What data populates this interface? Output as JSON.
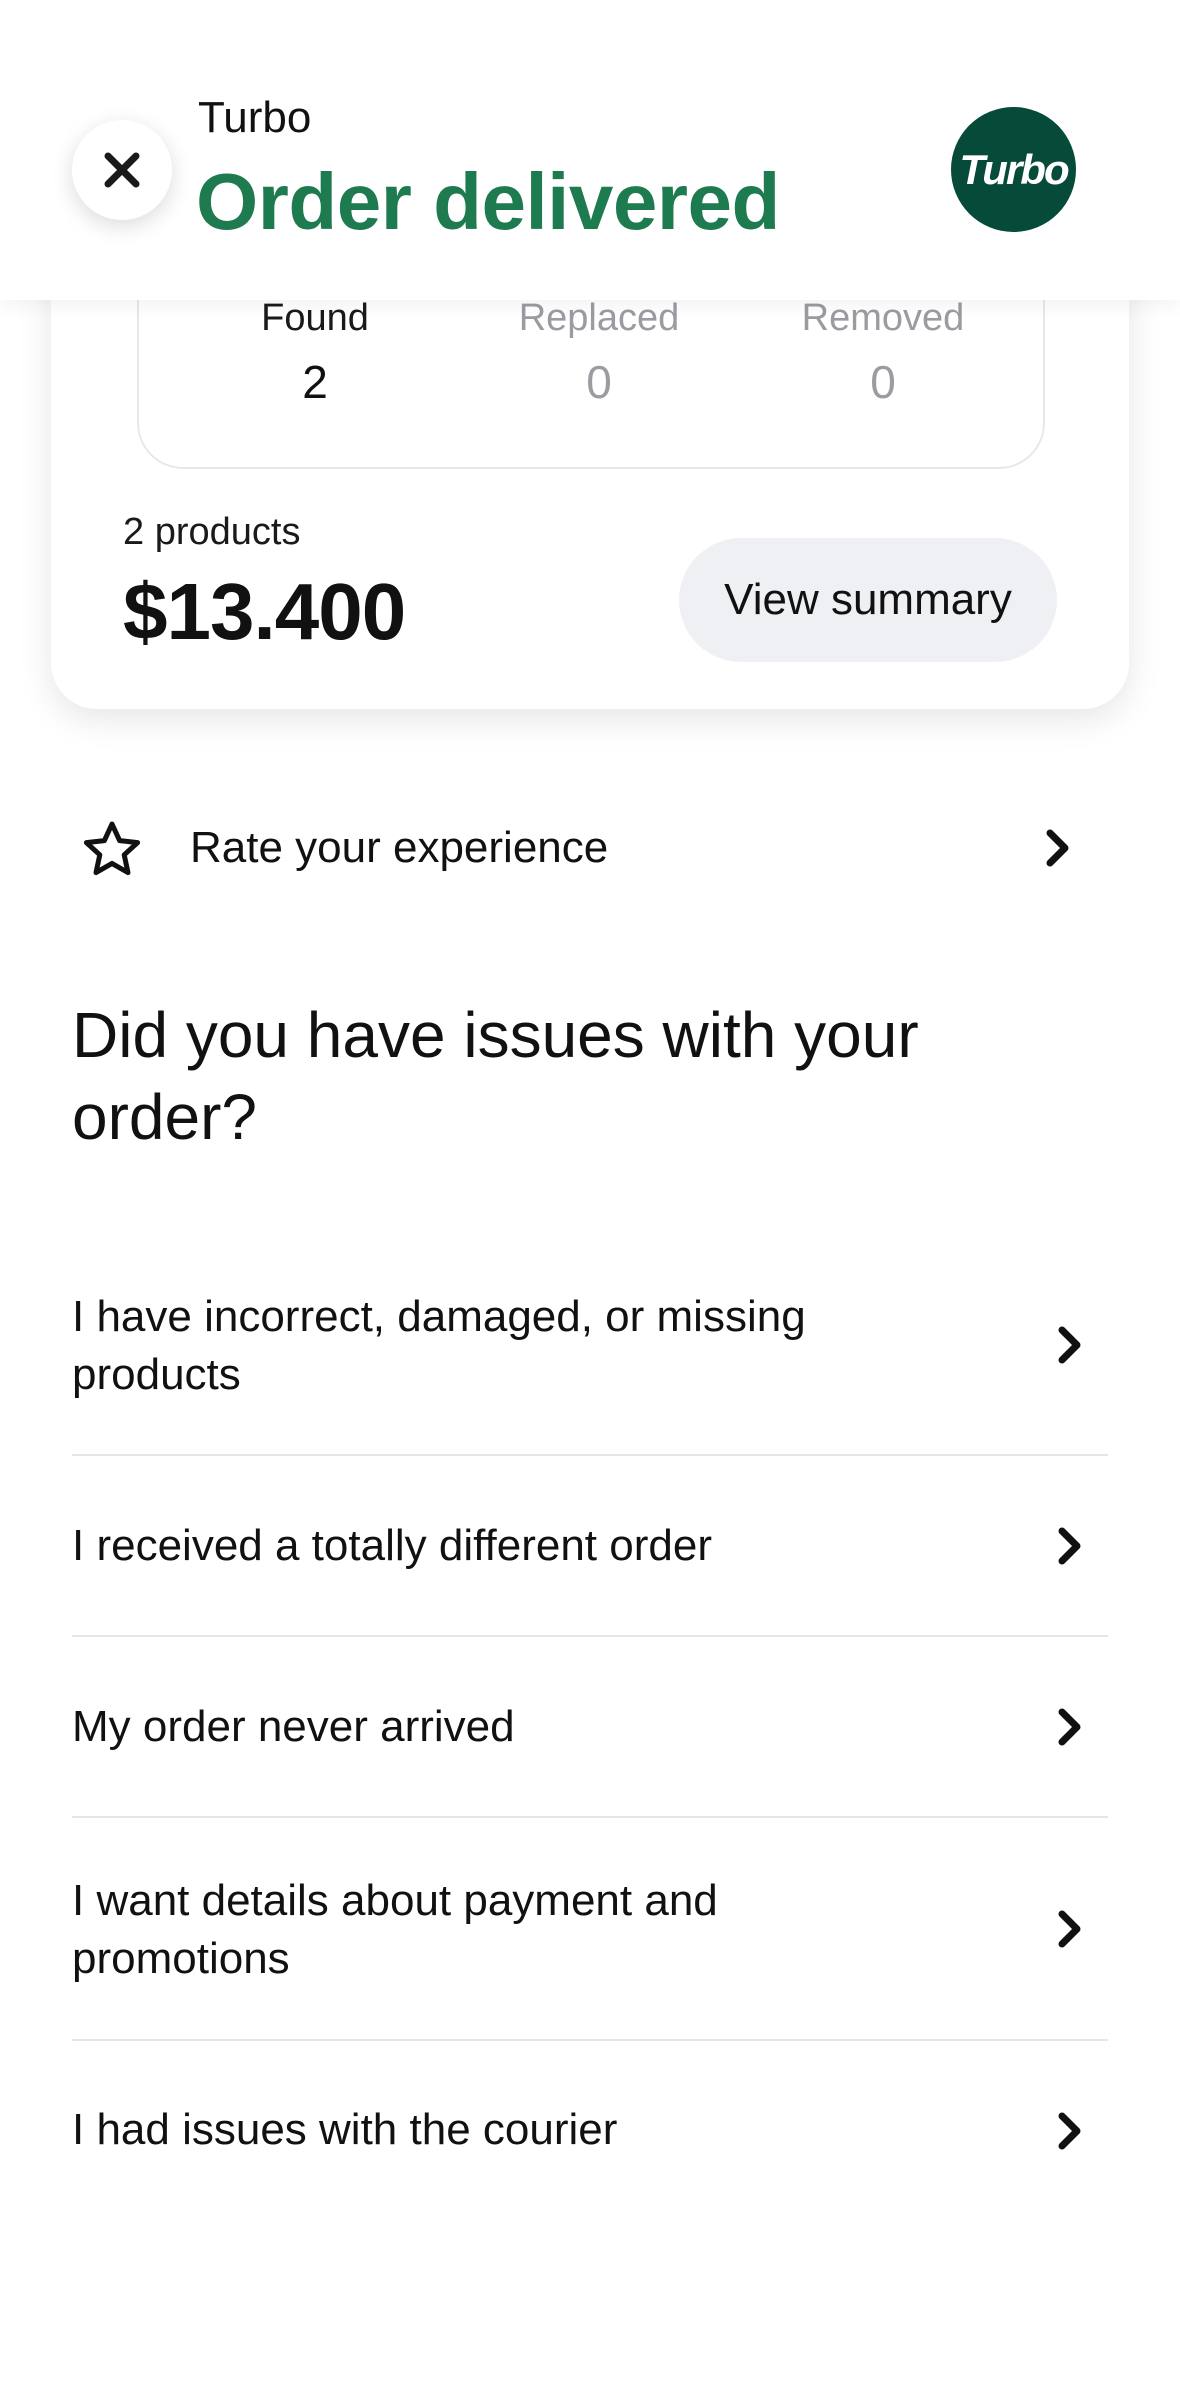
{
  "header": {
    "store_name": "Turbo",
    "order_status": "Order delivered",
    "logo_text": "Turbo",
    "close_icon": "close-icon"
  },
  "summary": {
    "stats": [
      {
        "label": "Found",
        "value": "2"
      },
      {
        "label": "Replaced",
        "value": "0"
      },
      {
        "label": "Removed",
        "value": "0"
      }
    ],
    "products_count": "2 products",
    "total": "$13.400",
    "view_summary_label": "View summary"
  },
  "rate": {
    "icon": "star-icon",
    "label": "Rate your experience"
  },
  "issues": {
    "heading": "Did you have issues with your order?",
    "items": [
      {
        "label": "I have incorrect, damaged, or missing products"
      },
      {
        "label": "I received a totally different order"
      },
      {
        "label": "My order never arrived"
      },
      {
        "label": "I want details about payment and promotions"
      },
      {
        "label": "I had issues with the courier"
      }
    ]
  },
  "colors": {
    "accent_green": "#1e7a4f",
    "logo_bg": "#064a3a",
    "muted_text": "#9a9ca2",
    "button_bg": "#eef0f3"
  }
}
